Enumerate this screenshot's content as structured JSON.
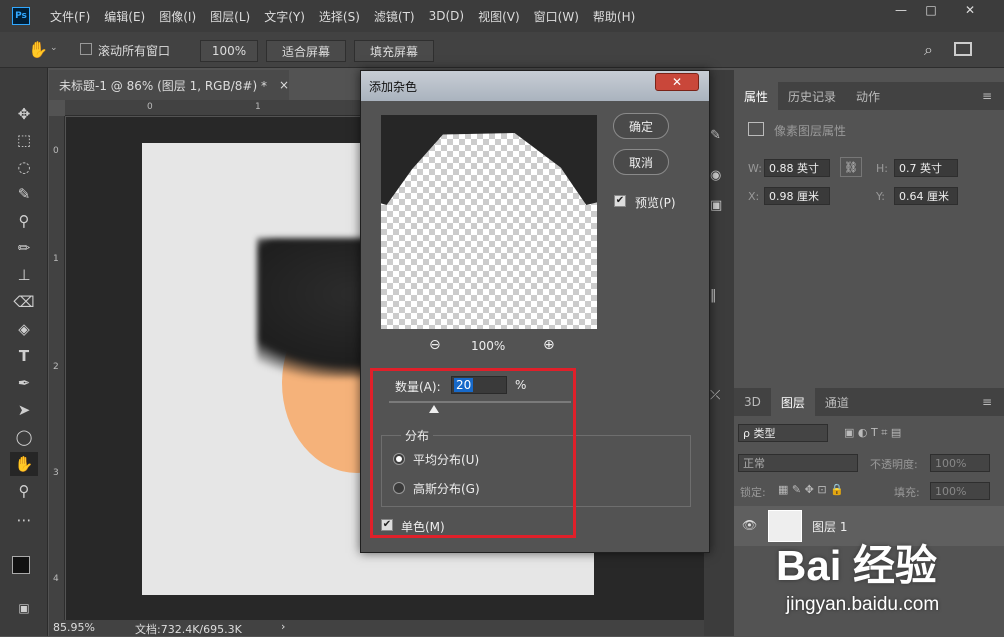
{
  "app": {
    "logo": "Ps"
  },
  "menu": [
    "文件(F)",
    "编辑(E)",
    "图像(I)",
    "图层(L)",
    "文字(Y)",
    "选择(S)",
    "滤镜(T)",
    "3D(D)",
    "视图(V)",
    "窗口(W)",
    "帮助(H)"
  ],
  "window_controls": {
    "minimize": "—",
    "maximize": "□",
    "close": "✕"
  },
  "options_bar": {
    "scroll_all": "滚动所有窗口",
    "zoom_100": "100%",
    "fit_screen": "适合屏幕",
    "fill_screen": "填充屏幕"
  },
  "document": {
    "tab_title": "未标题-1 @ 86% (图层 1, RGB/8#) *",
    "tab_close": "×",
    "ruler_top": [
      "0",
      "1"
    ],
    "ruler_left": [
      "0",
      "1",
      "2",
      "3",
      "4"
    ],
    "zoom": "85.95%",
    "doc_info": "文档:732.4K/695.3K"
  },
  "dialog": {
    "title": "添加杂色",
    "close": "✕",
    "ok": "确定",
    "cancel": "取消",
    "preview_label": "预览(P)",
    "preview_checked": true,
    "zoom_out": "⊖",
    "zoom_level": "100%",
    "zoom_in": "⊕",
    "amount_label": "数量(A):",
    "amount_value": "20",
    "amount_unit": "%",
    "distribution_label": "分布",
    "uniform": "平均分布(U)",
    "uniform_selected": true,
    "gaussian": "高斯分布(G)",
    "monochrome": "单色(M)",
    "monochrome_checked": true
  },
  "properties_panel": {
    "tabs": [
      "属性",
      "历史记录",
      "动作"
    ],
    "subtitle": "像素图层属性",
    "w_label": "W:",
    "w_value": "0.88 英寸",
    "h_label": "H:",
    "h_value": "0.7 英寸",
    "x_label": "X:",
    "x_value": "0.98 厘米",
    "y_label": "Y:",
    "y_value": "0.64 厘米"
  },
  "layers_panel": {
    "tabs": [
      "3D",
      "图层",
      "通道"
    ],
    "filter_kind": "ρ 类型",
    "blend_mode": "正常",
    "opacity_label": "不透明度:",
    "opacity_value": "100%",
    "lock_label": "锁定:",
    "fill_label": "填充:",
    "fill_value": "100%",
    "layer_name": "图层 1"
  },
  "watermark": {
    "logo": "Bai 经验",
    "url": "jingyan.baidu.com"
  }
}
